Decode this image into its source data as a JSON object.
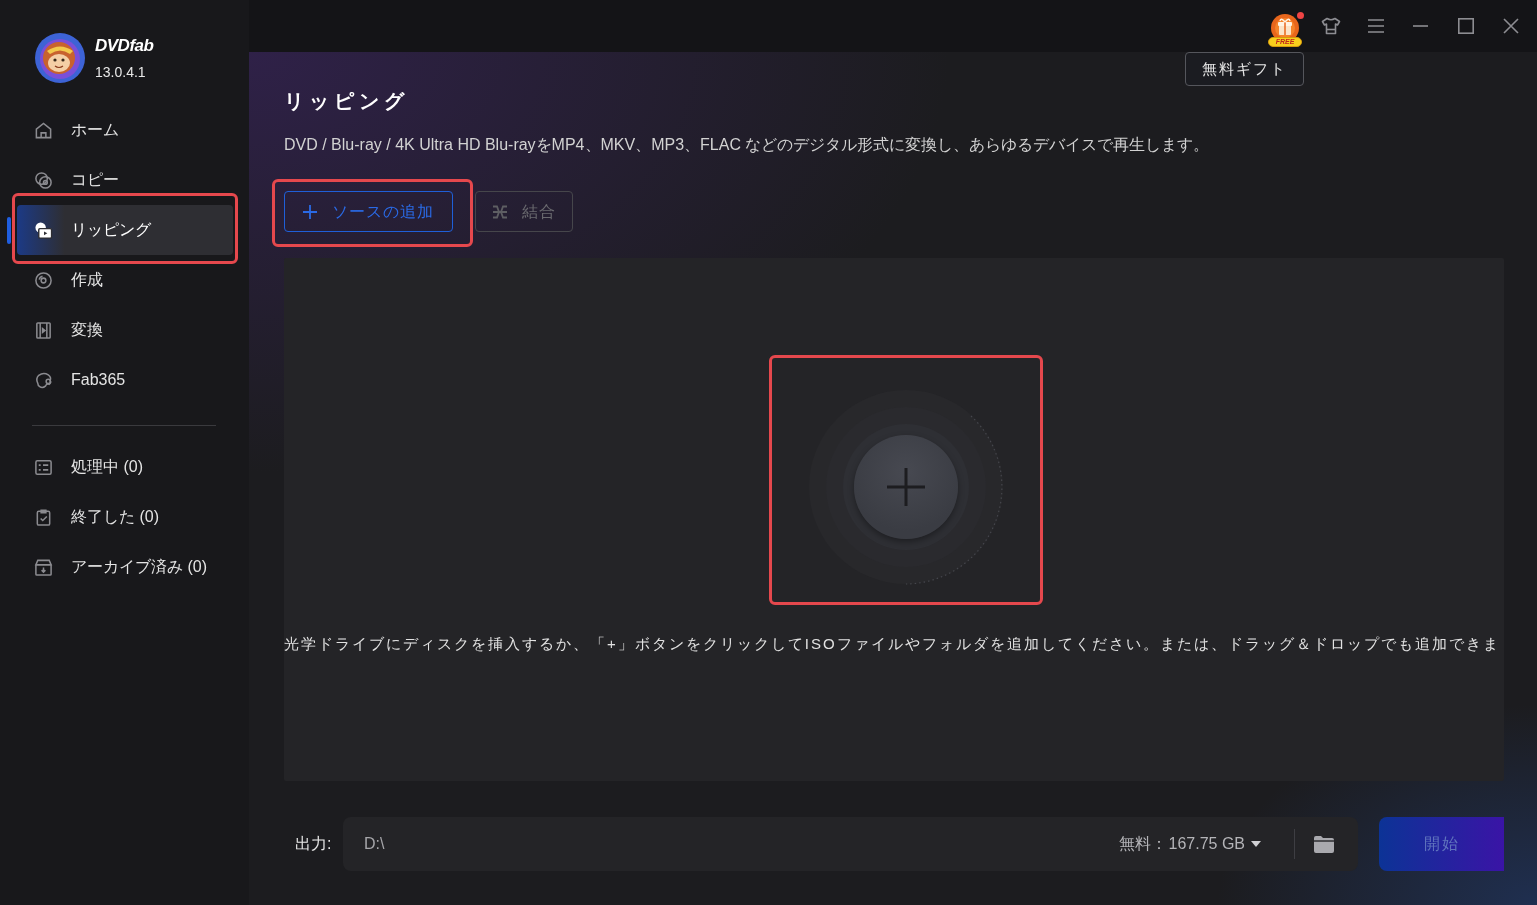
{
  "app": {
    "name": "DVDfab",
    "version": "13.0.4.1"
  },
  "sidebar": {
    "nav": [
      {
        "label": "ホーム",
        "selected": false,
        "highlighted": false
      },
      {
        "label": "コピー",
        "selected": false,
        "highlighted": false
      },
      {
        "label": "リッピング",
        "selected": true,
        "highlighted": true
      },
      {
        "label": "作成",
        "selected": false,
        "highlighted": false
      },
      {
        "label": "変換",
        "selected": false,
        "highlighted": false
      },
      {
        "label": "Fab365",
        "selected": false,
        "highlighted": false
      }
    ],
    "queues": [
      {
        "label": "処理中 (0)"
      },
      {
        "label": "終了した (0)"
      },
      {
        "label": "アーカイブ済み (0)"
      }
    ]
  },
  "title_bar": {
    "gift_badge": "FREE",
    "gift_notification": true,
    "gift_tooltip": "無料ギフト"
  },
  "page": {
    "title": "リッピング",
    "description": "DVD / Blu-ray / 4K Ultra HD Blu-rayをMP4、MKV、MP3、FLAC などのデジタル形式に変換し、あらゆるデバイスで再生します。",
    "toolbar": [
      {
        "label": "ソースの追加",
        "kind": "add",
        "disabled": false,
        "highlighted": true
      },
      {
        "label": "結合",
        "kind": "merge",
        "disabled": true,
        "highlighted": false
      }
    ],
    "drop_zone": {
      "highlighted": true,
      "hint": "光学ドライブにディスクを挿入するか、「+」ボタンをクリックしてISOファイルやフォルダを追加してください。または、ドラッグ＆ドロップでも追加できま"
    }
  },
  "output": {
    "label": "出力:",
    "path": "D:\\",
    "free_label": "無料：",
    "free_space": "167.75 GB",
    "start_button": {
      "label": "開始",
      "disabled": true
    }
  }
}
